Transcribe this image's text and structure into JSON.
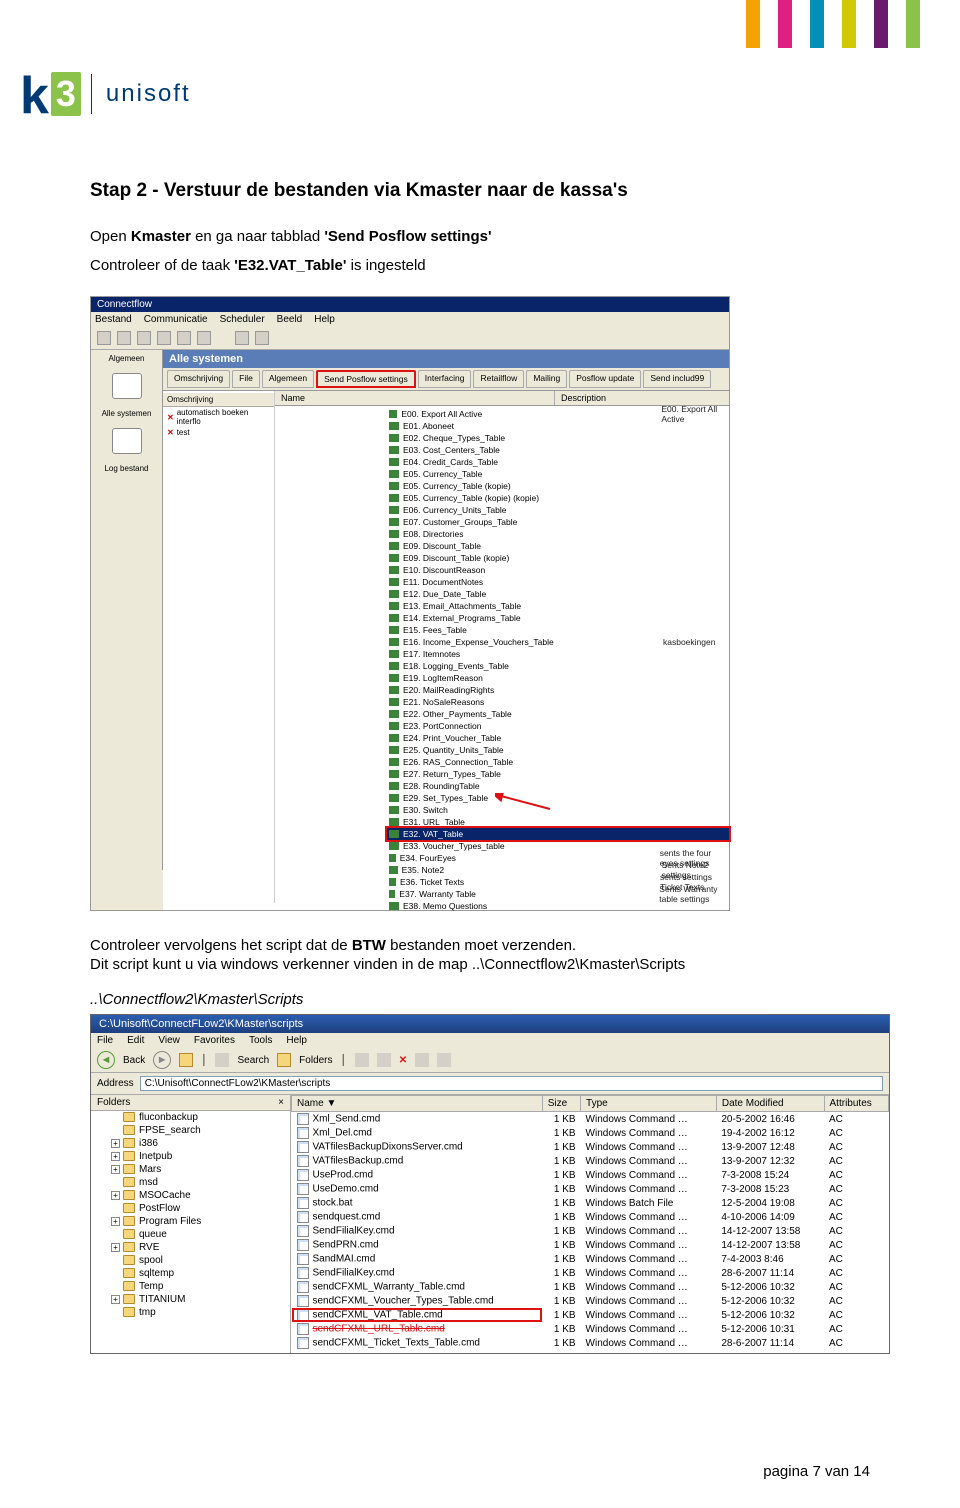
{
  "brand": {
    "k": "k",
    "three": "3",
    "unisoft": "unisoft"
  },
  "topbar_colors": [
    "#f4a100",
    "#e02080",
    "#008fb5",
    "#d0c800",
    "#6a1a6e",
    "#8bc34a"
  ],
  "heading": "Stap 2 - Verstuur de bestanden via Kmaster naar de kassa's",
  "intro_open": "Open ",
  "intro_kmaster": "Kmaster",
  "intro_mid": " en ga naar tabblad ",
  "intro_tab_q1": "'Send Posflow settings'",
  "intro_line2_a": "Controleer of de taak ",
  "intro_task_q": "'E32.VAT_Table'",
  "intro_line2_b": " is ingesteld",
  "cf": {
    "title": "Connectflow",
    "menus": [
      "Bestand",
      "Communicatie",
      "Scheduler",
      "Beeld",
      "Help"
    ],
    "side": {
      "algemeen": "Algemeen",
      "alle": "Alle systemen",
      "log": "Log bestand"
    },
    "banner": "Alle systemen",
    "tabs": [
      "Omschrijving",
      "File",
      "Algemeen",
      "Send Posflow settings",
      "Interfacing",
      "Retailflow",
      "Mailing",
      "Posflow update",
      "Send includ99"
    ],
    "cols": [
      "Name",
      "Description"
    ],
    "leftcol_hdr": "Omschrijving",
    "leftcol_items": [
      "automatisch boeken interflo",
      "test"
    ],
    "items": [
      {
        "n": "E00. Export All Active",
        "d": "E00. Export All Active"
      },
      {
        "n": "E01. Aboneet",
        "d": ""
      },
      {
        "n": "E02. Cheque_Types_Table",
        "d": ""
      },
      {
        "n": "E03. Cost_Centers_Table",
        "d": ""
      },
      {
        "n": "E04. Credit_Cards_Table",
        "d": ""
      },
      {
        "n": "E05. Currency_Table",
        "d": ""
      },
      {
        "n": "E05. Currency_Table (kopie)",
        "d": ""
      },
      {
        "n": "E05. Currency_Table (kopie) (kopie)",
        "d": ""
      },
      {
        "n": "E06. Currency_Units_Table",
        "d": ""
      },
      {
        "n": "E07. Customer_Groups_Table",
        "d": ""
      },
      {
        "n": "E08. Directories",
        "d": ""
      },
      {
        "n": "E09. Discount_Table",
        "d": ""
      },
      {
        "n": "E09. Discount_Table (kopie)",
        "d": ""
      },
      {
        "n": "E10. DiscountReason",
        "d": ""
      },
      {
        "n": "E11. DocumentNotes",
        "d": ""
      },
      {
        "n": "E12. Due_Date_Table",
        "d": ""
      },
      {
        "n": "E13. Email_Attachments_Table",
        "d": ""
      },
      {
        "n": "E14. External_Programs_Table",
        "d": ""
      },
      {
        "n": "E15. Fees_Table",
        "d": ""
      },
      {
        "n": "E16. Income_Expense_Vouchers_Table",
        "d": "kasboekingen"
      },
      {
        "n": "E17. Itemnotes",
        "d": ""
      },
      {
        "n": "E18. Logging_Events_Table",
        "d": ""
      },
      {
        "n": "E19. LogItemReason",
        "d": ""
      },
      {
        "n": "E20. MailReadingRights",
        "d": ""
      },
      {
        "n": "E21. NoSaleReasons",
        "d": ""
      },
      {
        "n": "E22. Other_Payments_Table",
        "d": ""
      },
      {
        "n": "E23. PortConnection",
        "d": ""
      },
      {
        "n": "E24. Print_Voucher_Table",
        "d": ""
      },
      {
        "n": "E25. Quantity_Units_Table",
        "d": ""
      },
      {
        "n": "E26. RAS_Connection_Table",
        "d": ""
      },
      {
        "n": "E27. Return_Types_Table",
        "d": ""
      },
      {
        "n": "E28. RoundingTable",
        "d": ""
      },
      {
        "n": "E29. Set_Types_Table",
        "d": ""
      },
      {
        "n": "E30. Switch",
        "d": ""
      },
      {
        "n": "E31. URL_Table",
        "d": ""
      },
      {
        "n": "E32. VAT_Table",
        "d": ""
      },
      {
        "n": "E33. Voucher_Types_table",
        "d": ""
      },
      {
        "n": "E34. FourEyes",
        "d": "sents the four eyes settings"
      },
      {
        "n": "E35. Note2",
        "d": "Sents Note2 settings"
      },
      {
        "n": "E36. Ticket Texts",
        "d": "sents settings Ticket Texts"
      },
      {
        "n": "E37. Warranty Table",
        "d": "Sents Warranty table settings"
      },
      {
        "n": "E38. Memo Questions",
        "d": ""
      }
    ]
  },
  "mid1": "Controleer vervolgens het script dat de ",
  "mid_bold": "BTW",
  "mid2": " bestanden moet verzenden.",
  "mid3": "Dit script kunt u via windows verkenner vinden in de map ..\\Connectflow2\\Kmaster\\Scripts",
  "italic_path": "..\\Connectflow2\\Kmaster\\Scripts",
  "exp": {
    "title": "C:\\Unisoft\\ConnectFLow2\\KMaster\\scripts",
    "menus": [
      "File",
      "Edit",
      "View",
      "Favorites",
      "Tools",
      "Help"
    ],
    "back": "Back",
    "search": "Search",
    "folders_btn": "Folders",
    "addr_label": "Address",
    "addr_value": "C:\\Unisoft\\ConnectFLow2\\KMaster\\scripts",
    "folders_hdr": "Folders",
    "folders_x": "×",
    "tree": [
      {
        "l": 1,
        "t": "fluconbackup"
      },
      {
        "l": 1,
        "t": "FPSE_search"
      },
      {
        "l": 1,
        "t": "i386",
        "ex": true
      },
      {
        "l": 1,
        "t": "Inetpub",
        "ex": true
      },
      {
        "l": 1,
        "t": "Mars",
        "ex": true
      },
      {
        "l": 1,
        "t": "msd"
      },
      {
        "l": 1,
        "t": "MSOCache",
        "ex": true
      },
      {
        "l": 1,
        "t": "PostFlow"
      },
      {
        "l": 1,
        "t": "Program Files",
        "ex": true
      },
      {
        "l": 1,
        "t": "queue"
      },
      {
        "l": 1,
        "t": "RVE",
        "ex": true
      },
      {
        "l": 1,
        "t": "spool"
      },
      {
        "l": 1,
        "t": "sqltemp"
      },
      {
        "l": 1,
        "t": "Temp"
      },
      {
        "l": 1,
        "t": "TITANIUM",
        "ex": true
      },
      {
        "l": 1,
        "t": "tmp"
      }
    ],
    "cols": [
      "Name ▼",
      "Size",
      "Type",
      "Date Modified",
      "Attributes"
    ],
    "rows": [
      {
        "n": "Xml_Send.cmd",
        "s": "1 KB",
        "t": "Windows Command …",
        "d": "20-5-2002 16:46",
        "a": "AC"
      },
      {
        "n": "Xml_Del.cmd",
        "s": "1 KB",
        "t": "Windows Command …",
        "d": "19-4-2002 16:12",
        "a": "AC"
      },
      {
        "n": "VATfilesBackupDixonsServer.cmd",
        "s": "1 KB",
        "t": "Windows Command …",
        "d": "13-9-2007 12:48",
        "a": "AC"
      },
      {
        "n": "VATfilesBackup.cmd",
        "s": "1 KB",
        "t": "Windows Command …",
        "d": "13-9-2007 12:32",
        "a": "AC"
      },
      {
        "n": "UseProd.cmd",
        "s": "1 KB",
        "t": "Windows Command …",
        "d": "7-3-2008 15:24",
        "a": "AC"
      },
      {
        "n": "UseDemo.cmd",
        "s": "1 KB",
        "t": "Windows Command …",
        "d": "7-3-2008 15:23",
        "a": "AC"
      },
      {
        "n": "stock.bat",
        "s": "1 KB",
        "t": "Windows Batch File",
        "d": "12-5-2004 19:08",
        "a": "AC"
      },
      {
        "n": "sendquest.cmd",
        "s": "1 KB",
        "t": "Windows Command …",
        "d": "4-10-2006 14:09",
        "a": "AC"
      },
      {
        "n": "SendFilialKey.cmd",
        "s": "1 KB",
        "t": "Windows Command …",
        "d": "14-12-2007 13:58",
        "a": "AC"
      },
      {
        "n": "SendPRN.cmd",
        "s": "1 KB",
        "t": "Windows Command …",
        "d": "14-12-2007 13:58",
        "a": "AC"
      },
      {
        "n": "SandMAI.cmd",
        "s": "1 KB",
        "t": "Windows Command …",
        "d": "7-4-2003 8:46",
        "a": "AC"
      },
      {
        "n": "SendFilialKey.cmd",
        "s": "1 KB",
        "t": "Windows Command …",
        "d": "28-6-2007 11:14",
        "a": "AC"
      },
      {
        "n": "sendCFXML_Warranty_Table.cmd",
        "s": "1 KB",
        "t": "Windows Command …",
        "d": "5-12-2006 10:32",
        "a": "AC"
      },
      {
        "n": "sendCFXML_Voucher_Types_Table.cmd",
        "s": "1 KB",
        "t": "Windows Command …",
        "d": "5-12-2006 10:32",
        "a": "AC"
      },
      {
        "n": "sendCFXML_VAT_Table.cmd",
        "s": "1 KB",
        "t": "Windows Command …",
        "d": "5-12-2006 10:32",
        "a": "AC",
        "hl": true
      },
      {
        "n": "sendCFXML_URL_Table.cmd",
        "s": "1 KB",
        "t": "Windows Command …",
        "d": "5-12-2006 10:31",
        "a": "AC",
        "strike": true
      },
      {
        "n": "sendCFXML_Ticket_Texts_Table.cmd",
        "s": "1 KB",
        "t": "Windows Command …",
        "d": "28-6-2007 11:14",
        "a": "AC"
      }
    ]
  },
  "footer": "pagina 7 van 14"
}
